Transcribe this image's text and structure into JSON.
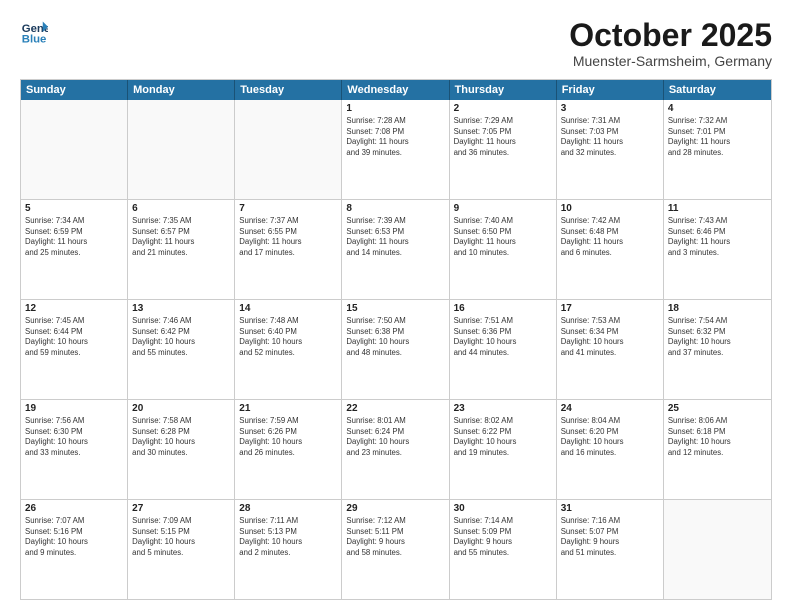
{
  "header": {
    "logo_line1": "General",
    "logo_line2": "Blue",
    "month": "October 2025",
    "location": "Muenster-Sarmsheim, Germany"
  },
  "weekdays": [
    "Sunday",
    "Monday",
    "Tuesday",
    "Wednesday",
    "Thursday",
    "Friday",
    "Saturday"
  ],
  "rows": [
    [
      {
        "day": "",
        "info": ""
      },
      {
        "day": "",
        "info": ""
      },
      {
        "day": "",
        "info": ""
      },
      {
        "day": "1",
        "info": "Sunrise: 7:28 AM\nSunset: 7:08 PM\nDaylight: 11 hours\nand 39 minutes."
      },
      {
        "day": "2",
        "info": "Sunrise: 7:29 AM\nSunset: 7:05 PM\nDaylight: 11 hours\nand 36 minutes."
      },
      {
        "day": "3",
        "info": "Sunrise: 7:31 AM\nSunset: 7:03 PM\nDaylight: 11 hours\nand 32 minutes."
      },
      {
        "day": "4",
        "info": "Sunrise: 7:32 AM\nSunset: 7:01 PM\nDaylight: 11 hours\nand 28 minutes."
      }
    ],
    [
      {
        "day": "5",
        "info": "Sunrise: 7:34 AM\nSunset: 6:59 PM\nDaylight: 11 hours\nand 25 minutes."
      },
      {
        "day": "6",
        "info": "Sunrise: 7:35 AM\nSunset: 6:57 PM\nDaylight: 11 hours\nand 21 minutes."
      },
      {
        "day": "7",
        "info": "Sunrise: 7:37 AM\nSunset: 6:55 PM\nDaylight: 11 hours\nand 17 minutes."
      },
      {
        "day": "8",
        "info": "Sunrise: 7:39 AM\nSunset: 6:53 PM\nDaylight: 11 hours\nand 14 minutes."
      },
      {
        "day": "9",
        "info": "Sunrise: 7:40 AM\nSunset: 6:50 PM\nDaylight: 11 hours\nand 10 minutes."
      },
      {
        "day": "10",
        "info": "Sunrise: 7:42 AM\nSunset: 6:48 PM\nDaylight: 11 hours\nand 6 minutes."
      },
      {
        "day": "11",
        "info": "Sunrise: 7:43 AM\nSunset: 6:46 PM\nDaylight: 11 hours\nand 3 minutes."
      }
    ],
    [
      {
        "day": "12",
        "info": "Sunrise: 7:45 AM\nSunset: 6:44 PM\nDaylight: 10 hours\nand 59 minutes."
      },
      {
        "day": "13",
        "info": "Sunrise: 7:46 AM\nSunset: 6:42 PM\nDaylight: 10 hours\nand 55 minutes."
      },
      {
        "day": "14",
        "info": "Sunrise: 7:48 AM\nSunset: 6:40 PM\nDaylight: 10 hours\nand 52 minutes."
      },
      {
        "day": "15",
        "info": "Sunrise: 7:50 AM\nSunset: 6:38 PM\nDaylight: 10 hours\nand 48 minutes."
      },
      {
        "day": "16",
        "info": "Sunrise: 7:51 AM\nSunset: 6:36 PM\nDaylight: 10 hours\nand 44 minutes."
      },
      {
        "day": "17",
        "info": "Sunrise: 7:53 AM\nSunset: 6:34 PM\nDaylight: 10 hours\nand 41 minutes."
      },
      {
        "day": "18",
        "info": "Sunrise: 7:54 AM\nSunset: 6:32 PM\nDaylight: 10 hours\nand 37 minutes."
      }
    ],
    [
      {
        "day": "19",
        "info": "Sunrise: 7:56 AM\nSunset: 6:30 PM\nDaylight: 10 hours\nand 33 minutes."
      },
      {
        "day": "20",
        "info": "Sunrise: 7:58 AM\nSunset: 6:28 PM\nDaylight: 10 hours\nand 30 minutes."
      },
      {
        "day": "21",
        "info": "Sunrise: 7:59 AM\nSunset: 6:26 PM\nDaylight: 10 hours\nand 26 minutes."
      },
      {
        "day": "22",
        "info": "Sunrise: 8:01 AM\nSunset: 6:24 PM\nDaylight: 10 hours\nand 23 minutes."
      },
      {
        "day": "23",
        "info": "Sunrise: 8:02 AM\nSunset: 6:22 PM\nDaylight: 10 hours\nand 19 minutes."
      },
      {
        "day": "24",
        "info": "Sunrise: 8:04 AM\nSunset: 6:20 PM\nDaylight: 10 hours\nand 16 minutes."
      },
      {
        "day": "25",
        "info": "Sunrise: 8:06 AM\nSunset: 6:18 PM\nDaylight: 10 hours\nand 12 minutes."
      }
    ],
    [
      {
        "day": "26",
        "info": "Sunrise: 7:07 AM\nSunset: 5:16 PM\nDaylight: 10 hours\nand 9 minutes."
      },
      {
        "day": "27",
        "info": "Sunrise: 7:09 AM\nSunset: 5:15 PM\nDaylight: 10 hours\nand 5 minutes."
      },
      {
        "day": "28",
        "info": "Sunrise: 7:11 AM\nSunset: 5:13 PM\nDaylight: 10 hours\nand 2 minutes."
      },
      {
        "day": "29",
        "info": "Sunrise: 7:12 AM\nSunset: 5:11 PM\nDaylight: 9 hours\nand 58 minutes."
      },
      {
        "day": "30",
        "info": "Sunrise: 7:14 AM\nSunset: 5:09 PM\nDaylight: 9 hours\nand 55 minutes."
      },
      {
        "day": "31",
        "info": "Sunrise: 7:16 AM\nSunset: 5:07 PM\nDaylight: 9 hours\nand 51 minutes."
      },
      {
        "day": "",
        "info": ""
      }
    ]
  ]
}
